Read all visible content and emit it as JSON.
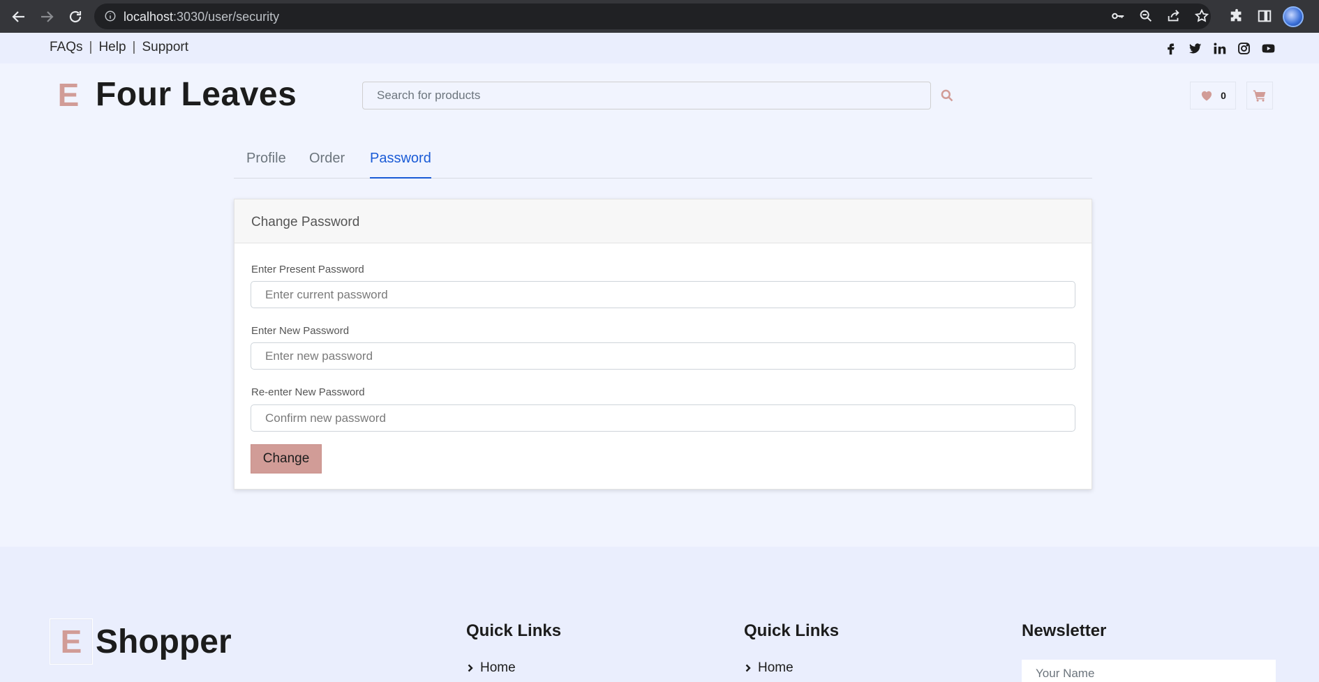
{
  "browser": {
    "url_host": "localhost",
    "url_path": ":3030/user/security"
  },
  "topbar": {
    "links": [
      "FAQs",
      "Help",
      "Support"
    ],
    "separator": "|",
    "socials": [
      "facebook-icon",
      "twitter-icon",
      "linkedin-icon",
      "instagram-icon",
      "youtube-icon"
    ]
  },
  "header": {
    "logo_mark": "E",
    "logo_name": "Four Leaves",
    "search_placeholder": "Search for products",
    "wishlist_count": "0"
  },
  "tabs": [
    {
      "label": "Profile",
      "active": false
    },
    {
      "label": "Order",
      "active": false
    },
    {
      "label": "Password",
      "active": true
    }
  ],
  "card": {
    "title": "Change Password",
    "fields": [
      {
        "label": "Enter Present Password",
        "placeholder": "Enter current password"
      },
      {
        "label": "Enter New Password",
        "placeholder": "Enter new password"
      },
      {
        "label": "Re-enter New Password",
        "placeholder": "Confirm new password"
      }
    ],
    "submit_label": "Change"
  },
  "footer": {
    "logo_mark": "E",
    "logo_name": "Shopper",
    "columns": [
      {
        "title": "Quick Links",
        "first_link": "Home"
      },
      {
        "title": "Quick Links",
        "first_link": "Home"
      }
    ],
    "newsletter_title": "Newsletter",
    "name_placeholder": "Your Name"
  },
  "colors": {
    "accent": "#d19c97",
    "active_tab": "#1a5bd6",
    "background": "#f1f4fe"
  }
}
